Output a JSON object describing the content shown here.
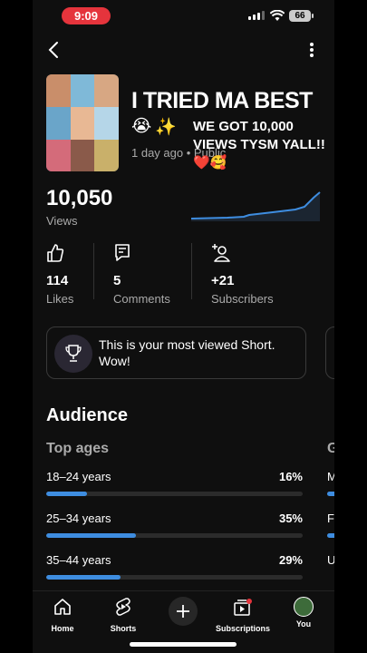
{
  "status_bar": {
    "time": "9:09",
    "battery": "66"
  },
  "video": {
    "title": "I TRIED MA BEST",
    "title_emoji": [
      "😭",
      "✨"
    ],
    "overlay_text": "WE GOT 10,000 VIEWS TYSM YALL!! ❤️🥰",
    "meta": "1 day ago • Public"
  },
  "views": {
    "count": "10,050",
    "label": "Views"
  },
  "stats": [
    {
      "value": "114",
      "label": "Likes",
      "icon": "thumbs-up-icon"
    },
    {
      "value": "5",
      "label": "Comments",
      "icon": "comment-icon"
    },
    {
      "value": "+21",
      "label": "Subscribers",
      "icon": "add-person-icon"
    }
  ],
  "highlight": {
    "text": "This is your most viewed Short. Wow!"
  },
  "audience": {
    "title": "Audience",
    "ages_title": "Top ages",
    "second_panel_title_peek": "G",
    "ages": [
      {
        "label": "18–24 years",
        "percent": "16%",
        "fraction": 0.16
      },
      {
        "label": "25–34 years",
        "percent": "35%",
        "fraction": 0.35
      },
      {
        "label": "35–44 years",
        "percent": "29%",
        "fraction": 0.29
      }
    ],
    "second_panel_peek": [
      "M",
      "F",
      "U"
    ]
  },
  "bottom_nav": {
    "home": "Home",
    "shorts": "Shorts",
    "subscriptions": "Subscriptions",
    "you": "You"
  },
  "colors": {
    "accent_blue": "#3e8de0",
    "status_red": "#e5343c",
    "background": "#0f0f0f"
  }
}
